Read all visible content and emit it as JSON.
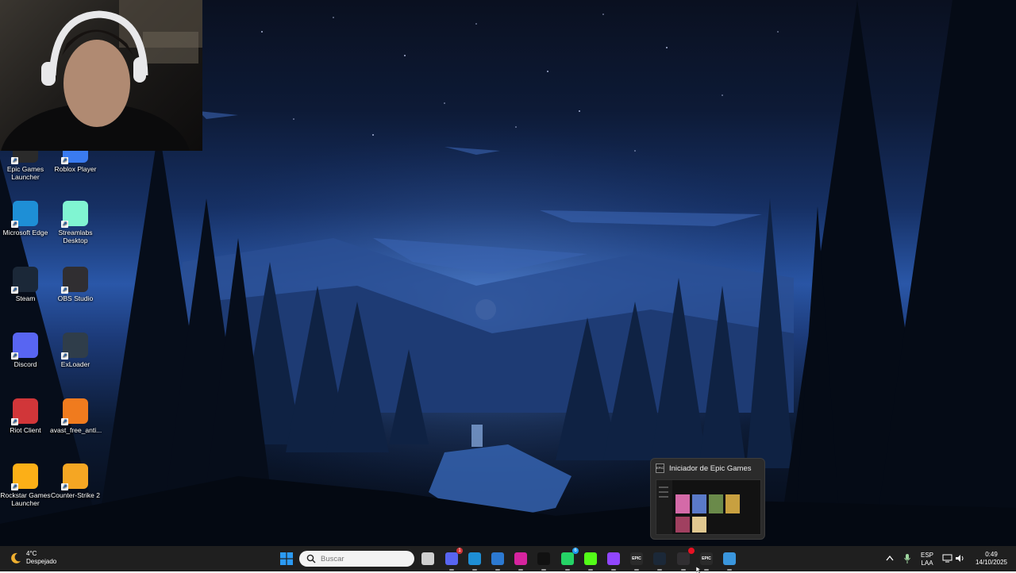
{
  "desktop": {
    "icons": [
      {
        "label": "Epic Games Launcher",
        "icon": "epic-games-icon",
        "color": "#2a2a2a"
      },
      {
        "label": "Roblox Player",
        "icon": "roblox-icon",
        "color": "#3a7bf0"
      },
      {
        "label": "Microsoft Edge",
        "icon": "edge-icon",
        "color": "#1e8fd6"
      },
      {
        "label": "Streamlabs Desktop",
        "icon": "streamlabs-icon",
        "color": "#80f5d2"
      },
      {
        "label": "Steam",
        "icon": "steam-icon",
        "color": "#1b2838"
      },
      {
        "label": "OBS Studio",
        "icon": "obs-icon",
        "color": "#302e31"
      },
      {
        "label": "Discord",
        "icon": "discord-icon",
        "color": "#5865f2"
      },
      {
        "label": "ExLoader",
        "icon": "exloader-icon",
        "color": "#2f3d4a"
      },
      {
        "label": "Riot Client",
        "icon": "riot-icon",
        "color": "#d13639"
      },
      {
        "label": "avast_free_anti...",
        "icon": "avast-icon",
        "color": "#f07b1e"
      },
      {
        "label": "Rockstar Games Launcher",
        "icon": "rockstar-icon",
        "color": "#fcaf17"
      },
      {
        "label": "Counter-Strike 2",
        "icon": "cs2-icon",
        "color": "#f5a623"
      }
    ]
  },
  "preview": {
    "title": "Iniciador de Epic Games",
    "epic_badge": "EPIC"
  },
  "taskbar": {
    "weather_temp": "4°C",
    "weather_desc": "Despejado",
    "search_placeholder": "Buscar",
    "apps": [
      {
        "name": "start-button",
        "icon": "windows-icon",
        "color": "#0078d4"
      },
      {
        "name": "task-view-button",
        "icon": "task-view-icon",
        "color": "#cfcfcf"
      },
      {
        "name": "discord-taskbar",
        "icon": "discord-icon",
        "color": "#5865f2",
        "badge": "1",
        "badge_color": "#d13438"
      },
      {
        "name": "edge-taskbar",
        "icon": "edge-icon",
        "color": "#1e8fd6"
      },
      {
        "name": "store-taskbar",
        "icon": "microsoft-store-icon",
        "color": "#2c79d1"
      },
      {
        "name": "instagram-taskbar",
        "icon": "instagram-icon",
        "color": "#d6249f"
      },
      {
        "name": "tiktok-taskbar",
        "icon": "tiktok-icon",
        "color": "#111111"
      },
      {
        "name": "whatsapp-taskbar",
        "icon": "whatsapp-icon",
        "color": "#25d366",
        "badge": "6",
        "badge_color": "#1d9bf0"
      },
      {
        "name": "kick-taskbar",
        "icon": "kick-icon",
        "color": "#53fc18"
      },
      {
        "name": "twitch-taskbar",
        "icon": "twitch-icon",
        "color": "#9146ff"
      },
      {
        "name": "epic-taskbar",
        "icon": "epic-games-icon",
        "color": "#2a2a2a",
        "text": "EPIC"
      },
      {
        "name": "steam-taskbar",
        "icon": "steam-icon",
        "color": "#1b2838"
      },
      {
        "name": "obs-taskbar",
        "icon": "obs-icon",
        "color": "#302e31",
        "badge": "",
        "badge_color": "#e81123"
      },
      {
        "name": "epic-active-taskbar",
        "icon": "epic-games-icon",
        "color": "#2a2a2a",
        "text": "EPIC"
      },
      {
        "name": "snip-taskbar",
        "icon": "snipping-tool-icon",
        "color": "#3a96dd"
      }
    ],
    "language": "ESP",
    "language_sub": "LAA",
    "time": "0:49",
    "date": "14/10/2025"
  }
}
